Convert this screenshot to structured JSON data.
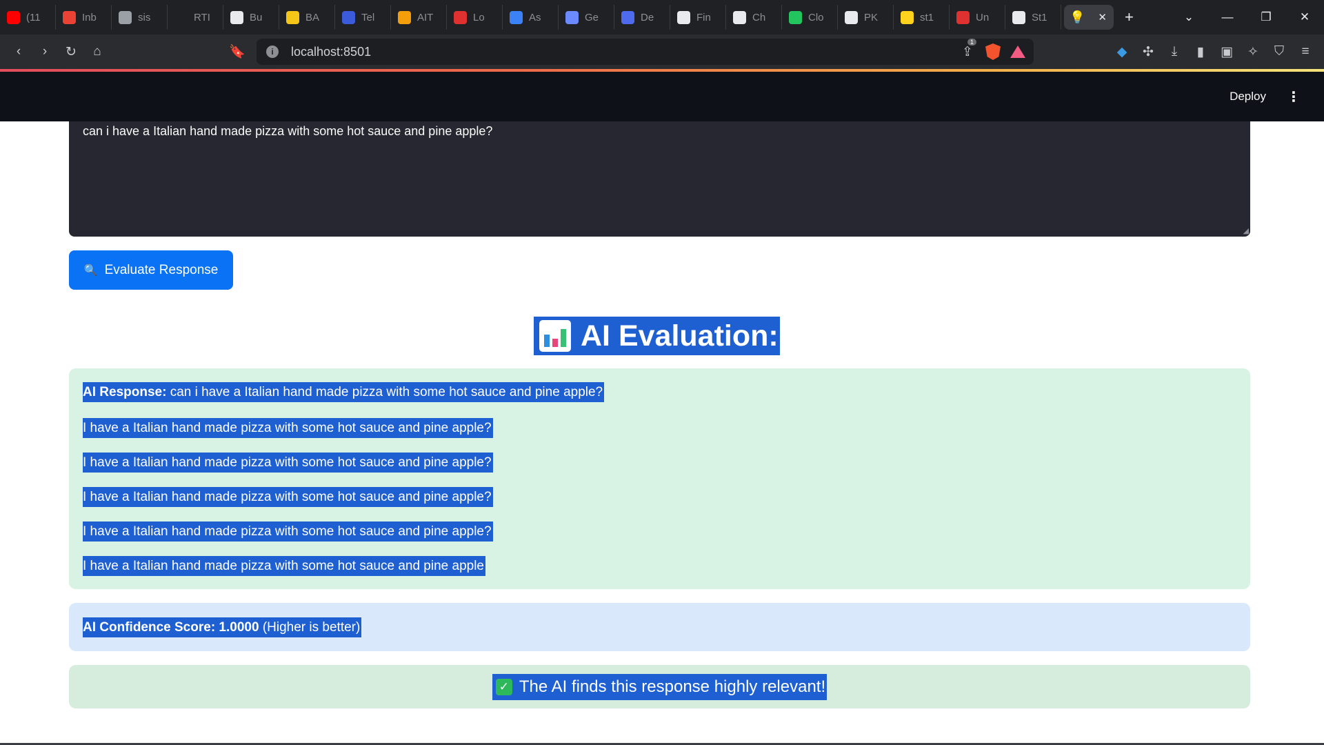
{
  "browser": {
    "tabs": [
      {
        "label": "(11",
        "icon": "youtube-icon",
        "color": "#ff0000"
      },
      {
        "label": "Inb",
        "icon": "gmail-icon",
        "color": "#ea4335"
      },
      {
        "label": "sis",
        "icon": "globe-icon",
        "color": "#9aa0a6"
      },
      {
        "label": "RTI",
        "icon": "blank-icon",
        "color": "#202124"
      },
      {
        "label": "Bu",
        "icon": "github-icon",
        "color": "#e8eaed"
      },
      {
        "label": "BA",
        "icon": "b-logo-icon",
        "color": "#f5c518"
      },
      {
        "label": "Tel",
        "icon": "telegram-icon",
        "color": "#3b5bdb"
      },
      {
        "label": "AIT",
        "icon": "ait-logo-icon",
        "color": "#f59e0b"
      },
      {
        "label": "Lo",
        "icon": "bug-icon",
        "color": "#e03131"
      },
      {
        "label": "As",
        "icon": "contact-icon",
        "color": "#3b82f6"
      },
      {
        "label": "Ge",
        "icon": "gemini-icon",
        "color": "#6b8afd"
      },
      {
        "label": "De",
        "icon": "deepseek-icon",
        "color": "#4f6bed"
      },
      {
        "label": "Fin",
        "icon": "copilot-icon",
        "color": "#e8eaed"
      },
      {
        "label": "Ch",
        "icon": "openai-icon",
        "color": "#e8eaed"
      },
      {
        "label": "Clo",
        "icon": "leaf-icon",
        "color": "#22c55e"
      },
      {
        "label": "PK",
        "icon": "github-icon",
        "color": "#e8eaed"
      },
      {
        "label": "st1",
        "icon": "huggingface-icon",
        "color": "#ffd21e"
      },
      {
        "label": "Un",
        "icon": "infinity-icon",
        "color": "#e03131"
      },
      {
        "label": "St1",
        "icon": "github-icon",
        "color": "#e8eaed"
      }
    ],
    "active_tab_icon": "lightbulb-icon",
    "url": "localhost:8501",
    "shields_count": "1"
  },
  "app": {
    "deploy_label": "Deploy",
    "input_text": "can i have a Italian hand made pizza with some hot sauce and pine apple?",
    "evaluate_button_label": "Evaluate Response",
    "evaluate_button_icon": "magnifier-icon",
    "eval_heading": "AI Evaluation:",
    "response_label": "AI Response:",
    "response_first": " can i have a Italian hand made pizza with some hot sauce and pine apple?",
    "response_lines": [
      "I have a Italian hand made pizza with some hot sauce and pine apple?",
      "I have a Italian hand made pizza with some hot sauce and pine apple?",
      "I have a Italian hand made pizza with some hot sauce and pine apple?",
      "I have a Italian hand made pizza with some hot sauce and pine apple?",
      "I have a Italian hand made pizza with some hot sauce and pine apple"
    ],
    "score_label": "AI Confidence Score: 1.0000",
    "score_note": " (Higher is better)",
    "success_message": "The AI finds this response highly relevant!"
  },
  "colors": {
    "accent": "#0a72f5",
    "selection": "#1e5fd1",
    "success_bg": "#d8f3e4",
    "info_bg": "#d9e9fb",
    "header_bg": "#0e1117"
  }
}
